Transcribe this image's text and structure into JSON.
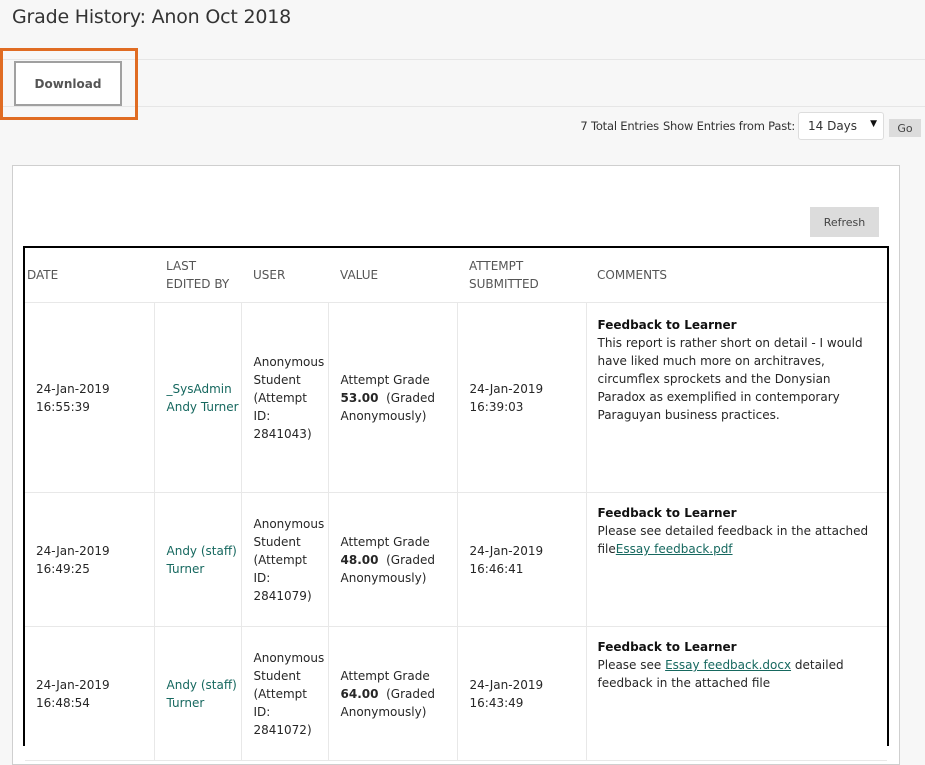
{
  "header": {
    "title": "Grade History: Anon Oct 2018"
  },
  "toolbar": {
    "download_label": "Download",
    "highlight_color": "#e06c23"
  },
  "filter": {
    "total_entries": "7 Total Entries",
    "show_label": "Show Entries from Past:",
    "selected_option": "14 Days",
    "go_label": "Go"
  },
  "panel": {
    "refresh_label": "Refresh"
  },
  "table": {
    "headers": {
      "date": "DATE",
      "last_edited_by_line1": "LAST",
      "last_edited_by_line2": "EDITED BY",
      "user": "USER",
      "value": "VALUE",
      "attempt_line1": "ATTEMPT",
      "attempt_line2": "SUBMITTED",
      "comments": "COMMENTS"
    },
    "rows": [
      {
        "date": "24-Jan-2019",
        "time": "16:55:39",
        "edited_by_line1": "_SysAdmin",
        "edited_by_line2": "Andy Turner",
        "user_line1": "Anonymous",
        "user_line2": "Student",
        "user_line3": "(Attempt ID:",
        "user_line4": "2841043)",
        "value_label": "Attempt Grade",
        "value_score": "53.00",
        "value_note": "(Graded",
        "value_note2": "Anonymously)",
        "attempt_date": "24-Jan-2019",
        "attempt_time": "16:39:03",
        "comment_title": "Feedback to Learner",
        "comment_text": "This report is rather short on detail - I would have liked much more on architraves, circumflex sprockets and the Donysian Paradox as exemplified in contemporary Paraguyan business practices."
      },
      {
        "date": "24-Jan-2019",
        "time": "16:49:25",
        "edited_by_line1": "Andy (staff)",
        "edited_by_line2": "Turner",
        "user_line1": "Anonymous",
        "user_line2": "Student",
        "user_line3": "(Attempt ID:",
        "user_line4": "2841079)",
        "value_label": "Attempt Grade",
        "value_score": "48.00",
        "value_note": "(Graded",
        "value_note2": "Anonymously)",
        "attempt_date": "24-Jan-2019",
        "attempt_time": "16:46:41",
        "comment_title": "Feedback to Learner",
        "comment_text": "Please see detailed feedback in the attached file",
        "comment_link": "Essay feedback.pdf"
      },
      {
        "date": "24-Jan-2019",
        "time": "16:48:54",
        "edited_by_line1": "Andy (staff)",
        "edited_by_line2": "Turner",
        "user_line1": "Anonymous",
        "user_line2": "Student",
        "user_line3": "(Attempt ID:",
        "user_line4": "2841072)",
        "value_label": "Attempt Grade",
        "value_score": "64.00",
        "value_note": "(Graded",
        "value_note2": "Anonymously)",
        "attempt_date": "24-Jan-2019",
        "attempt_time": "16:43:49",
        "comment_title": "Feedback to Learner",
        "comment_prefix": "Please see ",
        "comment_link": "Essay feedback.docx",
        "comment_suffix": " detailed feedback in the attached file"
      }
    ]
  }
}
